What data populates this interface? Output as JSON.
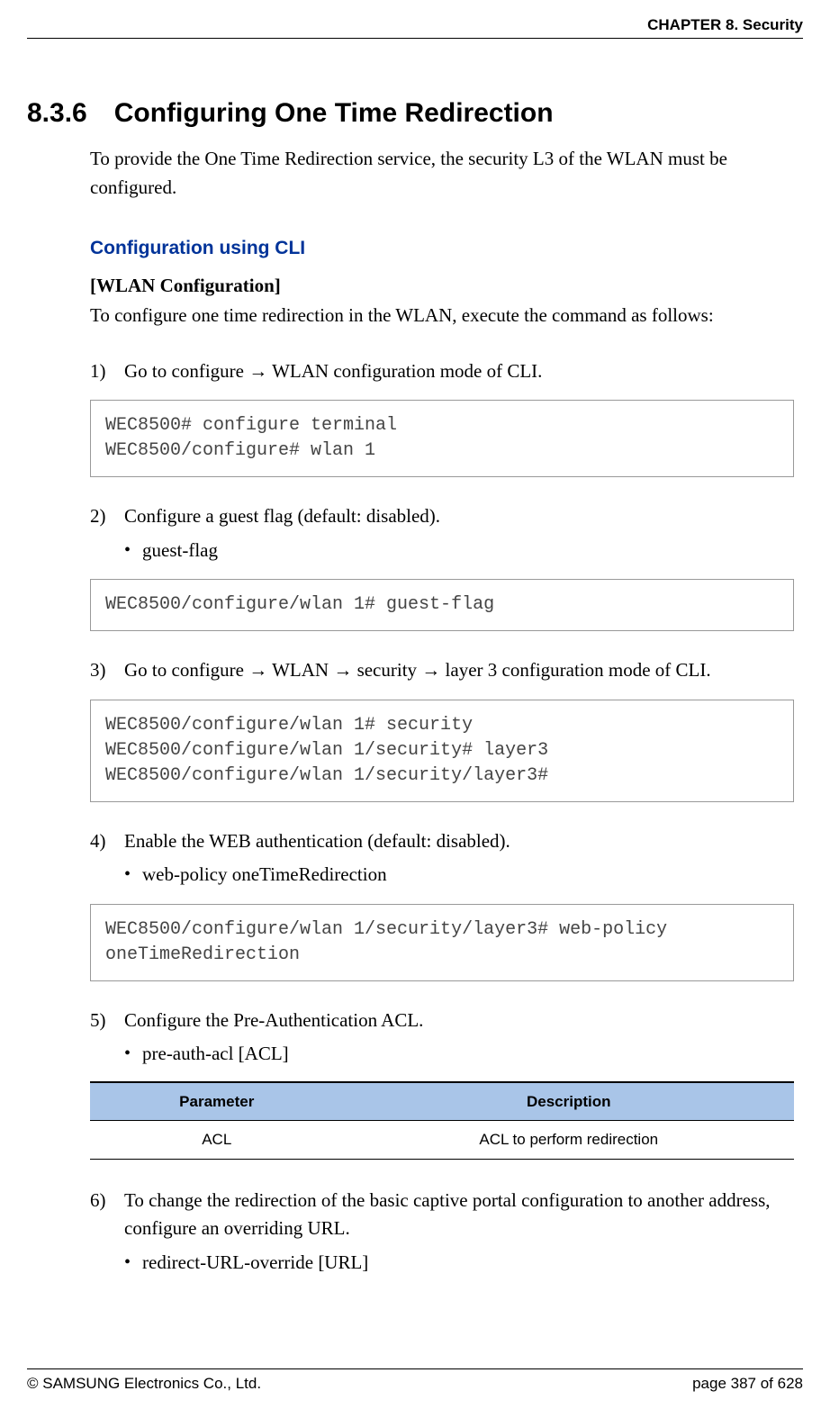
{
  "header": {
    "chapter": "CHAPTER 8. Security"
  },
  "section": {
    "number": "8.3.6",
    "title": "Configuring One Time Redirection",
    "intro": "To provide the One Time Redirection service, the security L3 of the WLAN must be configured."
  },
  "cli": {
    "heading": "Configuration using CLI",
    "wlan_config_label": "[WLAN Configuration]",
    "wlan_config_desc": "To configure one time redirection in the WLAN, execute the command as follows:"
  },
  "steps": {
    "s1": {
      "num": "1)",
      "text": "Go to configure → WLAN configuration mode of CLI.",
      "code": "WEC8500# configure terminal\nWEC8500/configure# wlan 1"
    },
    "s2": {
      "num": "2)",
      "text": "Configure a guest flag (default: disabled).",
      "bullet": "guest-flag",
      "code": "WEC8500/configure/wlan 1# guest-flag"
    },
    "s3": {
      "num": "3)",
      "text": "Go to configure → WLAN → security → layer 3 configuration mode of CLI.",
      "code": "WEC8500/configure/wlan 1# security\nWEC8500/configure/wlan 1/security# layer3\nWEC8500/configure/wlan 1/security/layer3#"
    },
    "s4": {
      "num": "4)",
      "text": "Enable the WEB authentication (default: disabled).",
      "bullet": "web-policy oneTimeRedirection",
      "code": "WEC8500/configure/wlan 1/security/layer3# web-policy oneTimeRedirection"
    },
    "s5": {
      "num": "5)",
      "text": "Configure the Pre-Authentication ACL.",
      "bullet": "pre-auth-acl [ACL]"
    },
    "s6": {
      "num": "6)",
      "text": "To change the redirection of the basic captive portal configuration to another address, configure an overriding URL.",
      "bullet": "redirect-URL-override [URL]"
    }
  },
  "table": {
    "h1": "Parameter",
    "h2": "Description",
    "r1c1": "ACL",
    "r1c2": "ACL to perform redirection"
  },
  "footer": {
    "copyright": "© SAMSUNG Electronics Co., Ltd.",
    "page": "page 387 of 628"
  },
  "glyphs": {
    "bullet": "•"
  }
}
